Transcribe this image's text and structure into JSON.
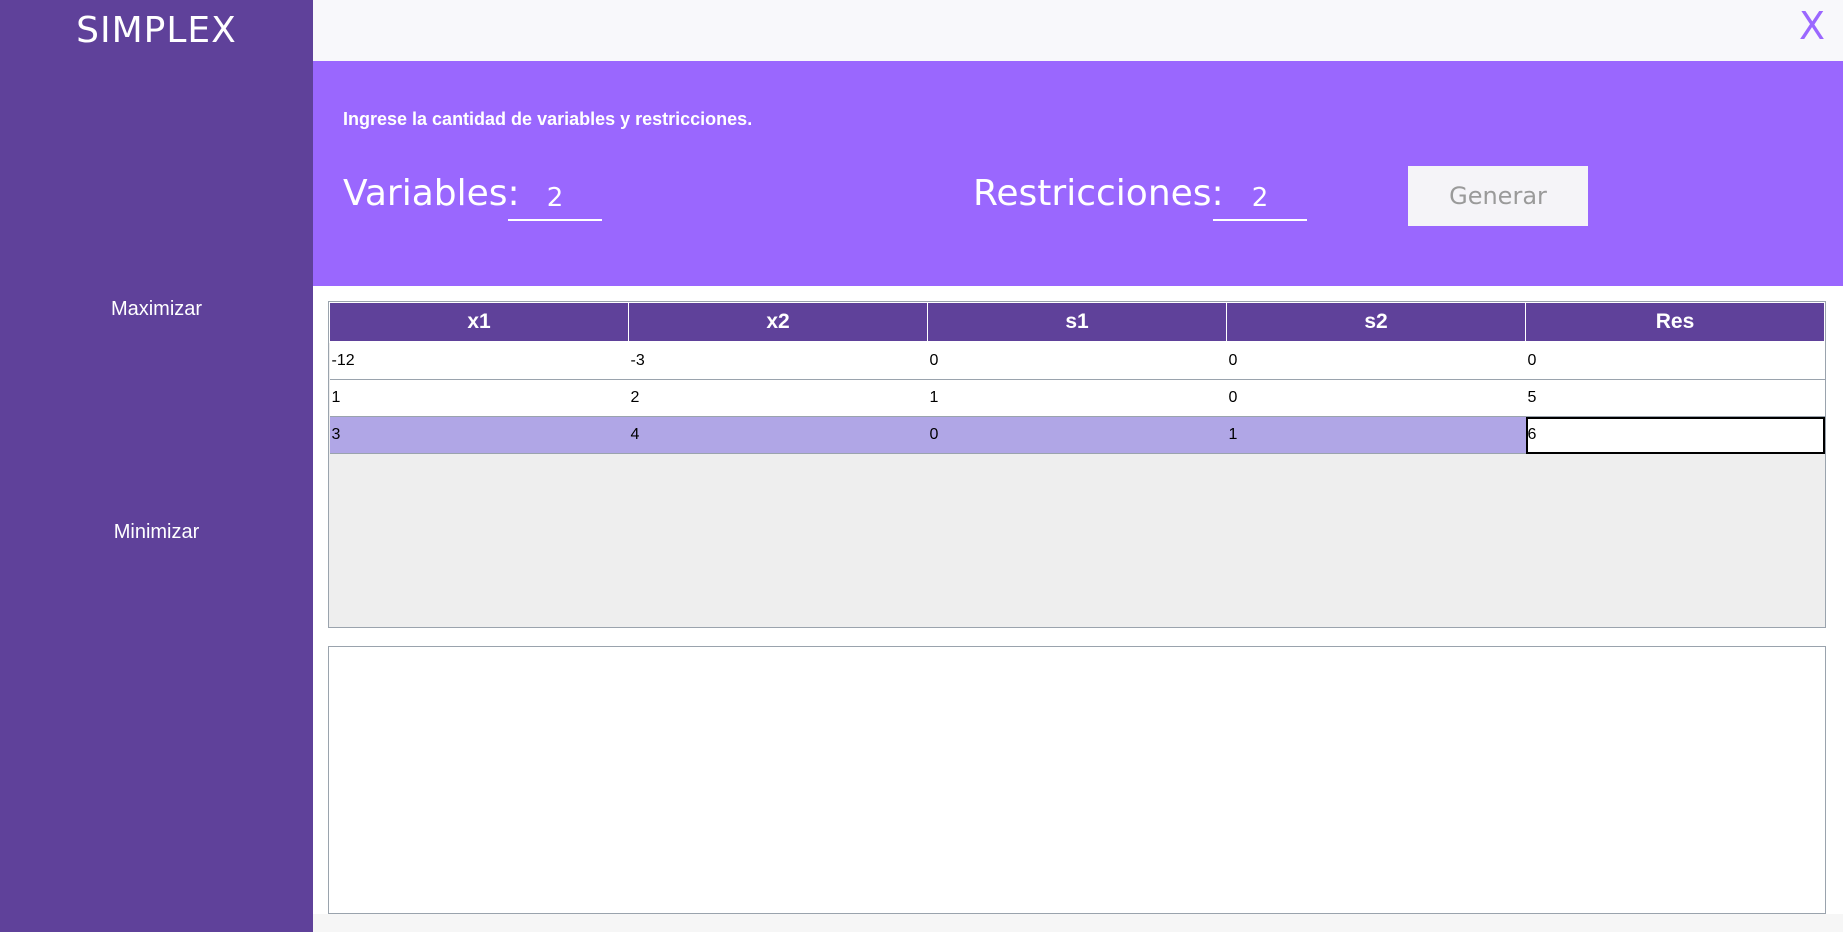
{
  "app": {
    "title": "SIMPLEX",
    "close_label": "X"
  },
  "sidebar": {
    "maximize_label": "Maximizar",
    "minimize_label": "Minimizar"
  },
  "banner": {
    "instructions": "Ingrese la cantidad de variables y restricciones.",
    "variables_label": "Variables:",
    "variables_value": "2",
    "restrictions_label": "Restricciones:",
    "restrictions_value": "2",
    "generate_label": "Generar"
  },
  "table": {
    "headers": [
      "x1",
      "x2",
      "s1",
      "s2",
      "Res"
    ],
    "rows": [
      [
        "-12",
        "-3",
        "0",
        "0",
        "0"
      ],
      [
        "1",
        "2",
        "1",
        "0",
        "5"
      ],
      [
        "3",
        "4",
        "0",
        "1",
        "6"
      ]
    ],
    "selected_row": 2
  },
  "result": {
    "text": ""
  },
  "colors": {
    "sidebar": "#5f419a",
    "banner": "#9a67fe",
    "close": "#9b67ff",
    "selected_row": "#b0a6e6"
  }
}
